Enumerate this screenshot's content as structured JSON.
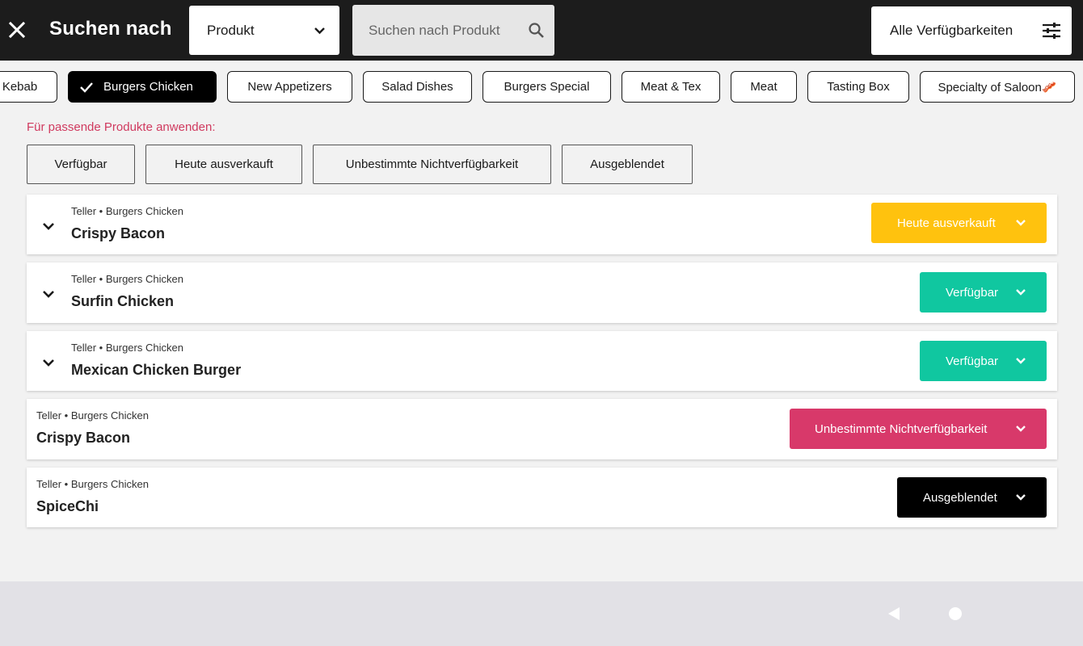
{
  "header": {
    "title": "Suchen nach",
    "select_value": "Produkt",
    "search_placeholder": "Suchen nach Produkt",
    "availability_button": "Alle Verfügbarkeiten"
  },
  "categories": [
    {
      "label": "Kebab"
    },
    {
      "label": "Burgers Chicken",
      "active": true
    },
    {
      "label": "New Appetizers"
    },
    {
      "label": "Salad Dishes"
    },
    {
      "label": "Burgers Special"
    },
    {
      "label": "Meat & Tex"
    },
    {
      "label": "Meat"
    },
    {
      "label": "Tasting Box"
    },
    {
      "label": "Specialty of Saloon🥓"
    }
  ],
  "apply_label": "Für passende Produkte anwenden:",
  "filters": [
    "Verfügbar",
    "Heute ausverkauft",
    "Unbestimmte Nichtverfügbarkeit",
    "Ausgeblendet"
  ],
  "products": [
    {
      "meta": "Teller • Burgers Chicken",
      "name": "Crispy Bacon",
      "status": "Heute ausverkauft",
      "status_color": "#ffc20e",
      "expandable": true
    },
    {
      "meta": "Teller • Burgers Chicken",
      "name": "Surfin Chicken",
      "status": "Verfügbar",
      "status_color": "#10c7a0",
      "expandable": true
    },
    {
      "meta": "Teller • Burgers Chicken",
      "name": "Mexican Chicken Burger",
      "status": "Verfügbar",
      "status_color": "#10c7a0",
      "expandable": true
    },
    {
      "meta": "Teller • Burgers Chicken",
      "name": "Crispy Bacon",
      "status": "Unbestimmte Nichtverfügbarkeit",
      "status_color": "#d8396a",
      "expandable": false
    },
    {
      "meta": "Teller • Burgers Chicken",
      "name": "SpiceChi",
      "status": "Ausgeblendet",
      "status_color": "#000000",
      "expandable": false
    }
  ],
  "icons": {
    "close": "close-icon",
    "dropdown": "chevron-down-icon",
    "search": "search-icon",
    "filter": "sliders-icon",
    "check": "check-icon",
    "nav_back": "triangle-back-icon",
    "nav_home": "circle-home-icon"
  }
}
